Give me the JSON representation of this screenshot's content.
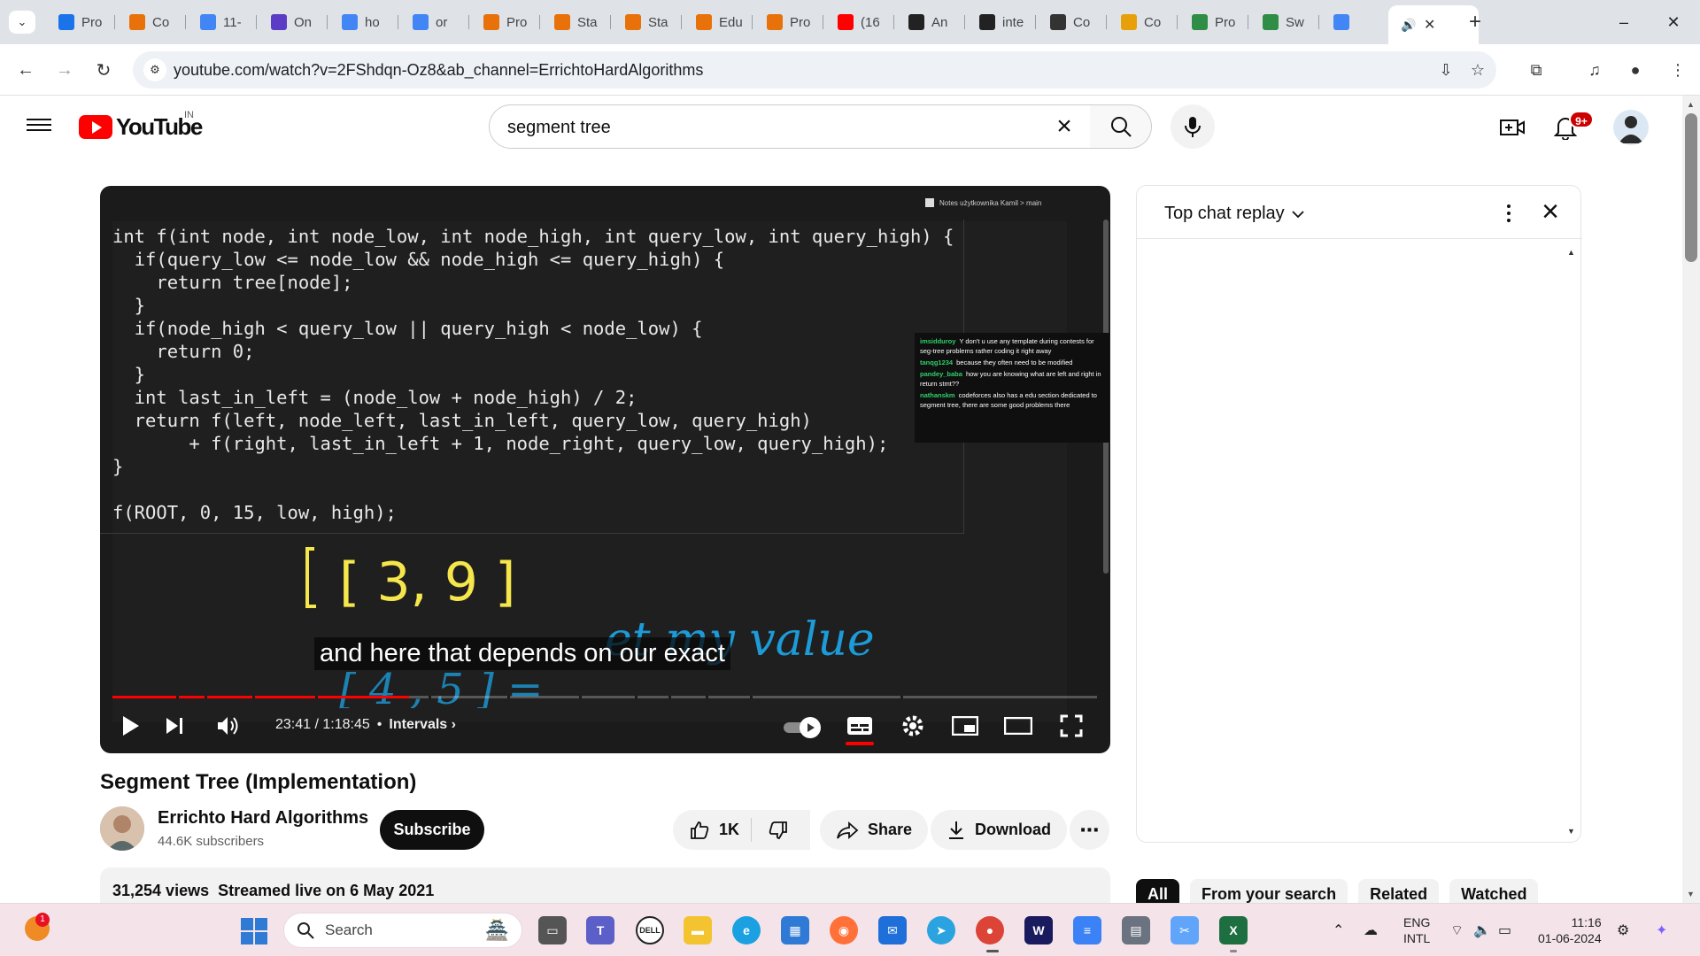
{
  "browser": {
    "tabs": [
      {
        "label": "Pro",
        "icon": "youtube-icon",
        "color": "#1a73e8"
      },
      {
        "label": "Co",
        "icon": "chart-icon",
        "color": "#e8710a"
      },
      {
        "label": "11-",
        "icon": "google-icon",
        "color": "#4285f4"
      },
      {
        "label": "On",
        "icon": "p-icon",
        "color": "#5b3cc4"
      },
      {
        "label": "ho",
        "icon": "google-icon",
        "color": "#4285f4"
      },
      {
        "label": "or",
        "icon": "google-icon",
        "color": "#4285f4"
      },
      {
        "label": "Pro",
        "icon": "chart-icon",
        "color": "#e8710a"
      },
      {
        "label": "Sta",
        "icon": "chart-icon",
        "color": "#e8710a"
      },
      {
        "label": "Sta",
        "icon": "chart-icon",
        "color": "#e8710a"
      },
      {
        "label": "Edu",
        "icon": "chart-icon",
        "color": "#e8710a"
      },
      {
        "label": "Pro",
        "icon": "chart-icon",
        "color": "#e8710a"
      },
      {
        "label": "(16",
        "icon": "youtube-icon",
        "color": "#ff0000"
      },
      {
        "label": "An",
        "icon": "play-icon",
        "color": "#222222"
      },
      {
        "label": "inte",
        "icon": "github-icon",
        "color": "#222222"
      },
      {
        "label": "Co",
        "icon": "cfv-icon",
        "color": "#333333"
      },
      {
        "label": "Co",
        "icon": "chevron-icon",
        "color": "#e8a00a"
      },
      {
        "label": "Pro",
        "icon": "gfg-icon",
        "color": "#2f8d46"
      },
      {
        "label": "Sw",
        "icon": "gfg-icon",
        "color": "#2f8d46"
      },
      {
        "label": "",
        "icon": "google-icon",
        "color": "#4285f4"
      }
    ],
    "active_tab": {
      "sound": "🔊",
      "close": "✕"
    },
    "new_tab": "+",
    "url": "youtube.com/watch?v=2FShdqn-Oz8&ab_channel=ErrichtoHardAlgorithms"
  },
  "youtube": {
    "country": "IN",
    "logo_text": "YouTube",
    "search_value": "segment tree",
    "notification_count": "9+",
    "video": {
      "code_lines": [
        "int f(int node, int node_low, int node_high, int query_low, int query_high) {",
        "  if(query_low <= node_low && node_high <= query_high) {",
        "    return tree[node];",
        "  }",
        "  if(node_high < query_low || query_high < node_low) {",
        "    return 0;",
        "  }",
        "  int last_in_left = (node_low + node_high) / 2;",
        "  return f(left, node_left, last_in_left, query_low, query_high)",
        "       + f(right, last_in_left + 1, node_right, query_low, query_high);",
        "}",
        "",
        "f(ROOT, 0, 15, low, high);"
      ],
      "notes_header": "Notes użytkownika Kamil > main",
      "handwriting_yellow": "[ 3, 9 ]",
      "handwriting_blue": "et my value",
      "handwriting_blue_under": "[ 4 , 5 ] =",
      "overlay_chat": [
        {
          "user": "imsidduroy",
          "text": "Y don't u use any template during contests for seg-tree problems rather coding it right away"
        },
        {
          "user": "tanqg1234",
          "text": "because they often need to be modified"
        },
        {
          "user": "pandey_baba",
          "text": "how you are knowing what are left and right in return stmt??"
        },
        {
          "user": "nathanskm",
          "text": "codeforces also has a edu section dedicated to segment tree, there are some good problems there"
        }
      ],
      "subtitle": "and here that depends on our exact",
      "progress": 0.301,
      "current_time": "23:41",
      "duration": "1:18:45",
      "chapter": "Intervals"
    },
    "title": "Segment Tree (Implementation)",
    "channel": {
      "name": "Errichto Hard Algorithms",
      "subscribers": "44.6K subscribers"
    },
    "subscribe_label": "Subscribe",
    "likes": "1K",
    "share_label": "Share",
    "download_label": "Download",
    "views": "31,254 views",
    "streamed": "Streamed live on 6 May 2021",
    "chat_title": "Top chat replay",
    "chips": [
      "All",
      "From your search",
      "Related",
      "Watched"
    ]
  },
  "taskbar": {
    "notification_badge": "1",
    "search_placeholder": "Search",
    "lang_top": "ENG",
    "lang_bottom": "INTL",
    "time": "11:16",
    "date": "01-06-2024"
  }
}
